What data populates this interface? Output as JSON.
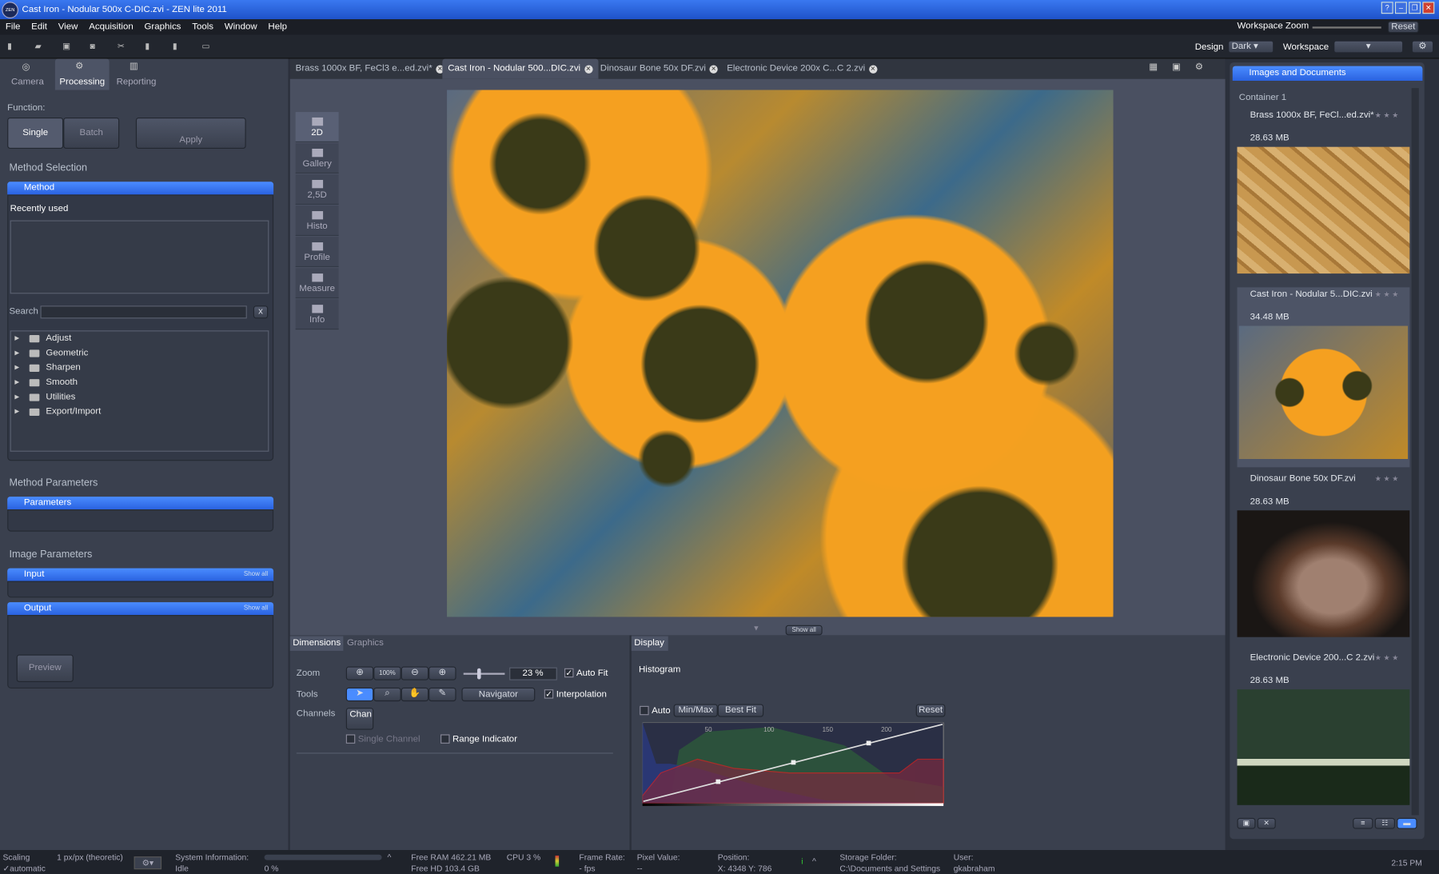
{
  "window": {
    "title": "Cast Iron - Nodular 500x C-DIC.zvi - ZEN lite 2011",
    "logo": "ZEN"
  },
  "menu": [
    "File",
    "Edit",
    "View",
    "Acquisition",
    "Graphics",
    "Tools",
    "Window",
    "Help"
  ],
  "topright": {
    "workspace_zoom": "Workspace Zoom",
    "reset": "Reset",
    "design_label": "Design",
    "design_value": "Dark",
    "workspace_label": "Workspace"
  },
  "left": {
    "tabs": [
      "Camera",
      "Processing",
      "Reporting"
    ],
    "function_label": "Function:",
    "single": "Single",
    "batch": "Batch",
    "apply": "Apply",
    "method_selection": "Method Selection",
    "method": "Method",
    "recently_used": "Recently used",
    "search_label": "Search",
    "tree": [
      "Adjust",
      "Geometric",
      "Sharpen",
      "Smooth",
      "Utilities",
      "Export/Import"
    ],
    "method_parameters": "Method Parameters",
    "parameters": "Parameters",
    "image_parameters": "Image Parameters",
    "input": "Input",
    "output": "Output",
    "show_all": "Show all",
    "preview": "Preview"
  },
  "doc_tabs": [
    "Brass 1000x BF, FeCl3 e...ed.zvi*",
    "Cast Iron - Nodular 500...DIC.zvi",
    "Dinosaur Bone 50x DF.zvi",
    "Electronic Device 200x C...C 2.zvi"
  ],
  "view_tools": [
    "2D",
    "Gallery",
    "2,5D",
    "Histo",
    "Profile",
    "Measure",
    "Info"
  ],
  "show_all": "Show all",
  "dimensions": {
    "tabs": [
      "Dimensions",
      "Graphics"
    ],
    "zoom_label": "Zoom",
    "zoom_100": "100%",
    "zoom_value": "23 %",
    "auto_fit": "Auto Fit",
    "tools_label": "Tools",
    "navigator": "Navigator",
    "interpolation": "Interpolation",
    "channels_label": "Channels",
    "chan": "Chan",
    "single_channel": "Single Channel",
    "range_indicator": "Range Indicator"
  },
  "display": {
    "tab": "Display",
    "histogram": "Histogram",
    "auto": "Auto",
    "minmax": "Min/Max",
    "bestfit": "Best Fit",
    "reset": "Reset",
    "ticks": [
      "50",
      "100",
      "150",
      "200"
    ]
  },
  "right": {
    "header": "Images and Documents",
    "container": "Container 1",
    "items": [
      {
        "name": "Brass 1000x BF, FeCl...ed.zvi*",
        "size": "28.63 MB"
      },
      {
        "name": "Cast Iron - Nodular 5...DIC.zvi",
        "size": "34.48 MB"
      },
      {
        "name": "Dinosaur Bone 50x DF.zvi",
        "size": "28.63 MB"
      },
      {
        "name": "Electronic Device 200...C 2.zvi",
        "size": "28.63 MB"
      }
    ],
    "stars": "★ ★ ★"
  },
  "status": {
    "scaling": "Scaling",
    "scaling_value": "1 px/px (theoretic)",
    "automatic": "automatic",
    "sysinfo": "System Information:",
    "idle": "Idle",
    "progress": "0 %",
    "ram": "Free RAM 462.21 MB",
    "cpu": "CPU 3 %",
    "hd": "Free HD   103.4 GB",
    "frame": "Frame Rate:",
    "fps": "- fps",
    "pixel": "Pixel Value:",
    "pixel_value": "--",
    "position": "Position:",
    "position_value": "X: 4348  Y: 786",
    "storage": "Storage Folder:",
    "storage_value": "C:\\Documents and Settings",
    "user": "User:",
    "user_value": "gkabraham",
    "time": "2:15 PM"
  }
}
